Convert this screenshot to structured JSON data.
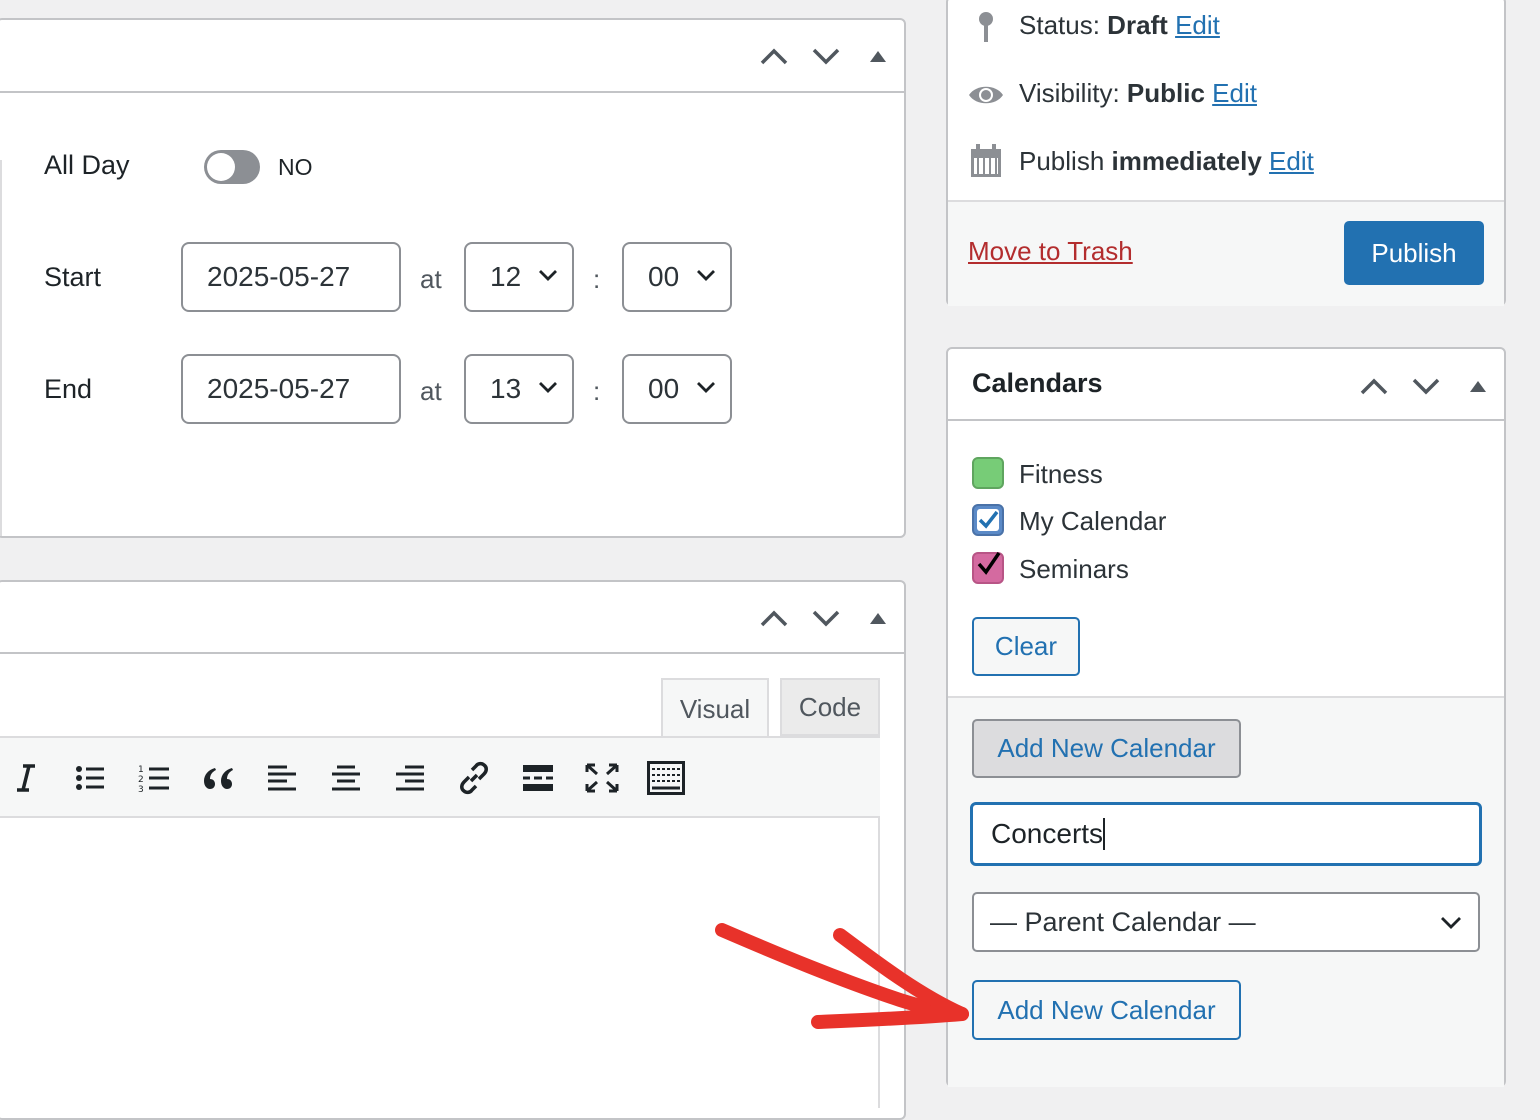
{
  "event_box": {
    "all_day_label": "All Day",
    "all_day_value": "NO",
    "start": {
      "label": "Start",
      "date": "2025-05-27",
      "at": "at",
      "hour": "12",
      "colon": ":",
      "minute": "00"
    },
    "end": {
      "label": "End",
      "date": "2025-05-27",
      "at": "at",
      "hour": "13",
      "colon": ":",
      "minute": "00"
    }
  },
  "editor": {
    "tabs": [
      "Visual",
      "Code"
    ],
    "toolbar_icons": [
      "italic-icon",
      "bullet-list-icon",
      "numbered-list-icon",
      "blockquote-icon",
      "align-left-icon",
      "align-center-icon",
      "align-right-icon",
      "link-icon",
      "read-more-icon",
      "fullscreen-icon",
      "toolbar-toggle-icon"
    ]
  },
  "publish": {
    "status_label": "Status:",
    "status_value": "Draft",
    "visibility_label": "Visibility:",
    "visibility_value": "Public",
    "publish_label": "Publish",
    "publish_value": "immediately",
    "edit": "Edit",
    "trash": "Move to Trash",
    "publish_button": "Publish"
  },
  "calendars": {
    "title": "Calendars",
    "items": [
      {
        "label": "Fitness",
        "color": "#77cc77",
        "checked": false
      },
      {
        "label": "My Calendar",
        "color": "#5b8ac7",
        "checked": true
      },
      {
        "label": "Seminars",
        "color": "#d46aa0",
        "checked": true
      }
    ],
    "clear": "Clear",
    "add_new_toggle": "Add New Calendar",
    "new_name_value": "Concerts",
    "parent_select": "— Parent Calendar —",
    "add_new_submit": "Add New Calendar"
  },
  "colors": {
    "accent": "#2271b1",
    "primary_button": "#2271b1",
    "trash": "#b32d2e",
    "arrow": "#e8322a"
  }
}
